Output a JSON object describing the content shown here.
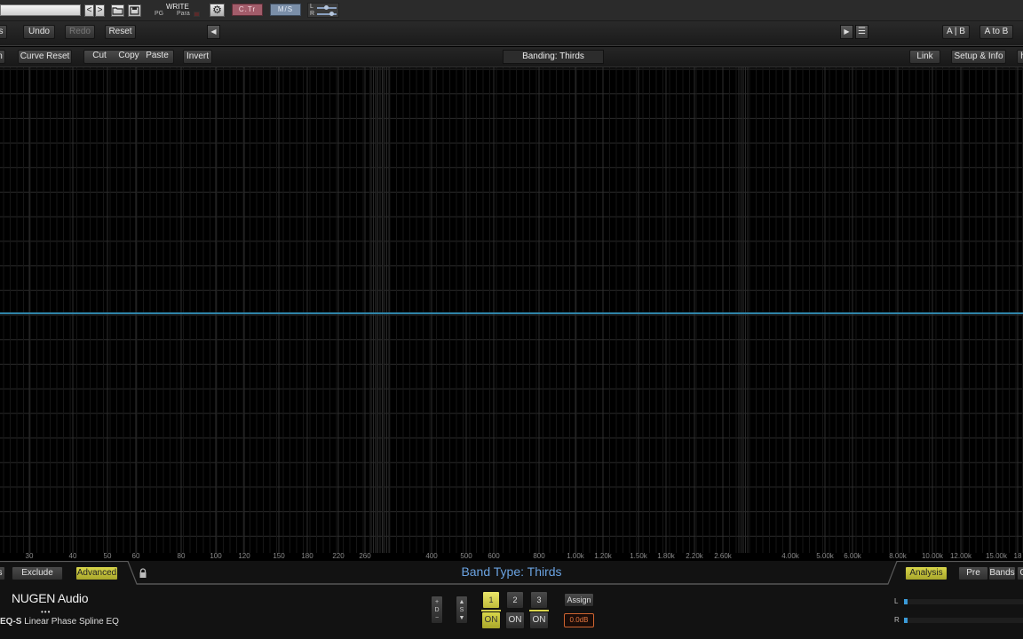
{
  "host": {
    "prev": "<",
    "next": ">",
    "write": "WRITE",
    "pg": "PG",
    "para": "Para",
    "ctr": "C.Tr",
    "ms": "M/S",
    "l": "L",
    "r": "R"
  },
  "toolbar": {
    "edge_left": "s",
    "undo": "Undo",
    "redo": "Redo",
    "reset": "Reset",
    "ab": "A | B",
    "a_to_b": "A to B"
  },
  "edit_bar": {
    "edge_left": "n",
    "curve_reset": "Curve Reset",
    "cut": "Cut",
    "copy": "Copy",
    "paste": "Paste",
    "invert": "Invert",
    "banding": "Banding: Thirds",
    "link": "Link",
    "setup_info": "Setup & Info",
    "edge_right": "h"
  },
  "freq_labels": [
    "30",
    "40",
    "50",
    "60",
    "80",
    "100",
    "120",
    "150",
    "180",
    "220",
    "260",
    "400",
    "500",
    "600",
    "800",
    "1.00k",
    "1.20k",
    "1.50k",
    "1.80k",
    "2.20k",
    "2.60k",
    "4.00k",
    "5.00k",
    "6.00k",
    "8.00k",
    "10.00k",
    "12.00k",
    "15.00k",
    "18"
  ],
  "bottom": {
    "edge_left": "s",
    "exclude": "Exclude",
    "advanced": "Advanced",
    "band_type": "Band Type: Thirds",
    "analysis": "Analysis",
    "pre": "Pre",
    "bands": "Bands",
    "bands_edge": "C",
    "brand": "NUGEN Audio",
    "brand_dots": "•••",
    "product_code": "EQ-S",
    "product_name": " Linear Phase Spline EQ",
    "dim_d": "D",
    "dim_s": "S",
    "bands_list": [
      {
        "num": "1",
        "on": "ON"
      },
      {
        "num": "2",
        "on": "ON"
      },
      {
        "num": "3",
        "on": "ON"
      }
    ],
    "assign": "Assign",
    "gain_readout": "0.0dB",
    "meter_l": "L",
    "meter_r": "R"
  },
  "colors": {
    "curve": "#2f84a8",
    "active": "#d6d04a",
    "label_blue": "#6aa2e0"
  }
}
